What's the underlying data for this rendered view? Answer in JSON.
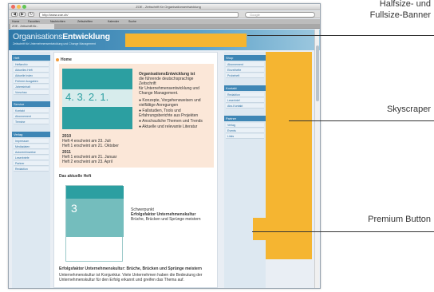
{
  "browser": {
    "window_title": "ZOE - Zeitschrift für Organisationsentwicklung",
    "url": "http://www.zoe.ch/",
    "search_placeholder": "Google",
    "bookmarks": [
      "Home",
      "Favoriten",
      "Nachrichten",
      "Zeitschriften",
      "Kalender",
      "Suche"
    ],
    "tab": "ZOE - Zeitschrift für..."
  },
  "site": {
    "logo_a": "Organisations",
    "logo_b": "Entwicklung",
    "tagline": "Zeitschrift für Unternehmensentwicklung und Change Management",
    "left_nav": [
      {
        "title": "Heft",
        "items": [
          "Heftarchiv",
          "Aktuelles Heft",
          "Aktuelle Index",
          "Frühere Ausgaben",
          "Jahresinhalt",
          "Vorschau"
        ]
      },
      {
        "title": "Service",
        "items": [
          "Kontakt",
          "Abonnement",
          "Termine"
        ]
      },
      {
        "title": "Verlag",
        "items": [
          "Impressum",
          "Mediadaten",
          "Autorenhinweise",
          "Leserbriefe",
          "Partner",
          "Redaktion"
        ]
      }
    ],
    "home_title": "Home",
    "issue_numbers": "4.  3.  2.  1.",
    "intro_title": "OrganisationsEntwicklung ist",
    "intro_lines": [
      "die führende deutschsprachige Zeitschrift",
      "für Unternehmensentwicklung und",
      "Change Management."
    ],
    "intro_bullets": [
      "Konzepte, Vorgehensweisen und vielfältige Anregungen",
      "Fallstudien, Tools und Erfahrungsberichte aus Projekten",
      "Anschauliche Themen und Trends",
      "Aktuelle und relevante Literatur"
    ],
    "dates_lines": [
      "2010",
      "Heft 4 erscheint am 23. Juli",
      "Heft 1 erscheint am 21. Oktober",
      "2011",
      "Heft 1 erscheint am 21. Januar",
      "Heft 2 erscheint am 23. April"
    ],
    "current_head": "Das aktuelle Heft",
    "current_issue_label": "Schwerpunkt",
    "current_issue_title": "Erfolgsfaktor Unternehmenskultur",
    "current_issue_sub": "Brüche, Brücken und Sprünge meistern",
    "cover_num": "3",
    "bottom_title": "Erfolgsfaktor Unternehmenskultur: Brüche, Brücken und Sprünge meistern",
    "bottom_text": "Unternehmenskultur ist Konjunktur. Viele Unternehmen haben die Bedeutung der Unternehmenskultur für den Erfolg erkannt und greifen das Thema auf.",
    "right_nav": [
      {
        "title": "Shop",
        "items": [
          "Abonnement",
          "Einzelhefte",
          "Probeheft"
        ]
      },
      {
        "title": "Kontakt",
        "items": [
          "Redaktion",
          "Leserbrief",
          "Abo-Kontakt"
        ]
      },
      {
        "title": "Partner",
        "items": [
          "Verlag",
          "Events",
          "Links"
        ]
      }
    ]
  },
  "annotations": {
    "banner": "Halfsize- und Fullsize-Banner",
    "banner_line1": "Halfsize- und",
    "banner_line2": "Fullsize-Banner",
    "skyscraper": "Skyscraper",
    "premium": "Premium Button"
  },
  "colors": {
    "ad_placeholder": "#f5b531",
    "header_blue": "#2e78a8",
    "teal": "#2c9fa1"
  }
}
